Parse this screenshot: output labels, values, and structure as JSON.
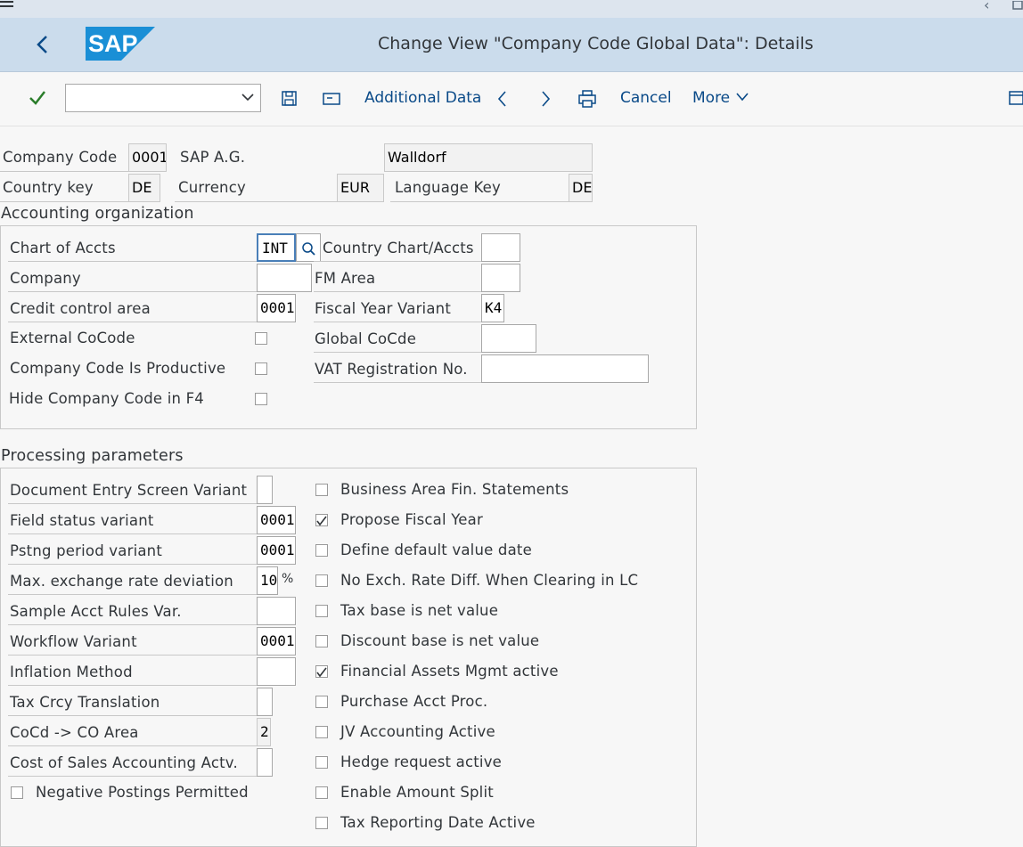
{
  "header": {
    "title": "Change View \"Company Code Global Data\": Details",
    "logo": "SAP"
  },
  "toolbar": {
    "command_field_value": "",
    "additional_data": "Additional Data",
    "cancel": "Cancel",
    "more": "More"
  },
  "header_fields": {
    "company_code_label": "Company Code",
    "company_code_value": "0001",
    "company_name": "SAP A.G.",
    "city": "Walldorf",
    "country_key_label": "Country key",
    "country_key_value": "DE",
    "currency_label": "Currency",
    "currency_value": "EUR",
    "language_key_label": "Language Key",
    "language_key_value": "DE"
  },
  "accounting_org": {
    "title": "Accounting organization",
    "chart_of_accts_label": "Chart of Accts",
    "chart_of_accts_value": "INT",
    "country_chart_label": "Country Chart/Accts",
    "country_chart_value": "",
    "company_label": "Company",
    "company_value": "",
    "fm_area_label": "FM Area",
    "fm_area_value": "",
    "credit_control_label": "Credit control area",
    "credit_control_value": "0001",
    "fiscal_year_variant_label": "Fiscal Year Variant",
    "fiscal_year_variant_value": "K4",
    "external_cocode_label": "External CoCode",
    "global_cocde_label": "Global CoCde",
    "global_cocde_value": "",
    "productive_label": "Company Code Is Productive",
    "vat_label": "VAT Registration No.",
    "vat_value": "",
    "hide_label": "Hide Company Code in F4"
  },
  "processing": {
    "title": "Processing parameters",
    "left": [
      {
        "label": "Document Entry Screen Variant",
        "value": ""
      },
      {
        "label": "Field status variant",
        "value": "0001"
      },
      {
        "label": "Pstng period variant",
        "value": "0001"
      },
      {
        "label": "Max. exchange rate deviation",
        "value": "10",
        "unit": "%"
      },
      {
        "label": "Sample Acct Rules Var.",
        "value": ""
      },
      {
        "label": "Workflow Variant",
        "value": "0001"
      },
      {
        "label": "Inflation Method",
        "value": ""
      },
      {
        "label": "Tax Crcy Translation",
        "value": ""
      },
      {
        "label": "CoCd -> CO Area",
        "value": "2"
      },
      {
        "label": "Cost of Sales Accounting Actv.",
        "value": ""
      }
    ],
    "negative_postings_label": "Negative Postings Permitted",
    "right": [
      {
        "label": "Business Area Fin. Statements",
        "checked": false
      },
      {
        "label": "Propose Fiscal Year",
        "checked": true
      },
      {
        "label": "Define default value date",
        "checked": false
      },
      {
        "label": "No Exch. Rate Diff. When Clearing in LC",
        "checked": false
      },
      {
        "label": "Tax base is net value",
        "checked": false
      },
      {
        "label": "Discount base is net value",
        "checked": false
      },
      {
        "label": "Financial Assets Mgmt active",
        "checked": true
      },
      {
        "label": "Purchase Acct Proc.",
        "checked": false
      },
      {
        "label": "JV Accounting Active",
        "checked": false
      },
      {
        "label": "Hedge request active",
        "checked": false
      },
      {
        "label": "Enable Amount Split",
        "checked": false
      },
      {
        "label": "Tax Reporting Date Active",
        "checked": false
      }
    ]
  },
  "colors": {
    "header_bg": "#cbdcec",
    "accent": "#0a4a88",
    "sap_blue": "#1a8fd6",
    "check_green": "#2b7d2b"
  }
}
